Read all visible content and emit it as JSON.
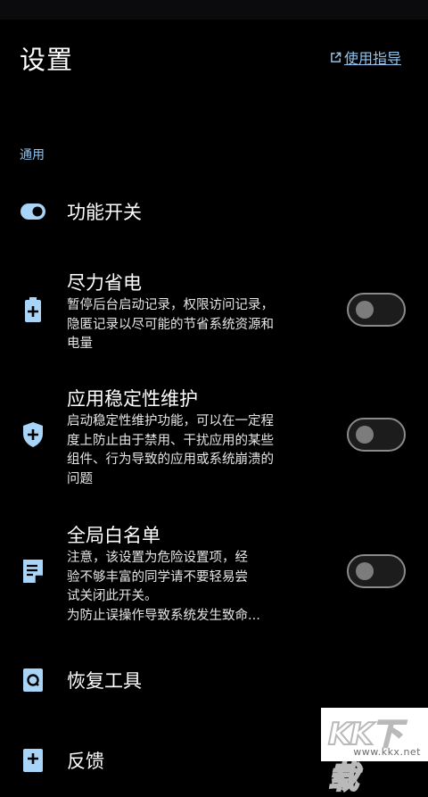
{
  "header": {
    "title": "设置",
    "guide_link": "使用指导"
  },
  "section": {
    "general": "通用"
  },
  "items": [
    {
      "title": "功能开关",
      "icon": "toggle-icon"
    },
    {
      "title": "尽力省电",
      "desc": "暂停后台启动记录，权限访问记录，隐匿记录以尽可能的节省系统资源和电量",
      "icon": "battery-icon",
      "enabled": false
    },
    {
      "title": "应用稳定性维护",
      "desc": "启动稳定性维护功能，可以在一定程度上防止由于禁用、干扰应用的某些组件、行为导致的应用或系统崩溃的问题",
      "icon": "shield-plus-icon",
      "enabled": false
    },
    {
      "title": "全局白名单",
      "desc_lines": [
        "注意，该设置为危险设置项，经",
        "验不够丰富的同学请不要轻易尝",
        "试关闭此开关。",
        "为防止误操作导致系统发生致命..."
      ],
      "icon": "document-list-icon",
      "enabled": false
    },
    {
      "title": "恢复工具",
      "icon": "restore-tool-icon"
    },
    {
      "title": "反馈",
      "icon": "feedback-icon"
    }
  ],
  "watermark": {
    "text": "KK下载",
    "url": "www.kkx.net"
  },
  "colors": {
    "background": "#000000",
    "accent": "#8fc3ee",
    "icon": "#a8d4f7"
  }
}
